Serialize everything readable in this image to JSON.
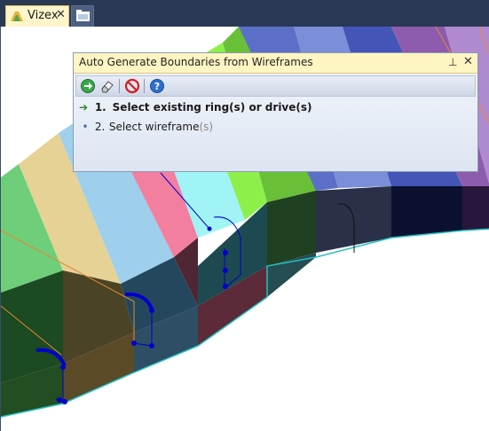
{
  "tabs": [
    {
      "label": "Vizex",
      "close": "✕",
      "icon": "vizex-icon",
      "active": true
    },
    {
      "label": "",
      "icon": "folder-icon",
      "active": false
    }
  ],
  "panel": {
    "title": "Auto Generate Boundaries from Wireframes",
    "pin_glyph": "⊥",
    "close_glyph": "✕",
    "toolbar": [
      "run-icon",
      "eraser-icon",
      "cancel-icon",
      "help-icon"
    ],
    "steps": [
      {
        "number": "1.",
        "text": "Select existing ring(s) or drive(s)",
        "current": true
      },
      {
        "number": "2.",
        "text_main": "Select wireframe",
        "text_suffix": "(s)",
        "current": false
      }
    ]
  },
  "colors": {
    "accent_tab": "#fff5cc",
    "chrome": "#293955",
    "wire": "#0000cc",
    "edge": "#20c0c0"
  }
}
